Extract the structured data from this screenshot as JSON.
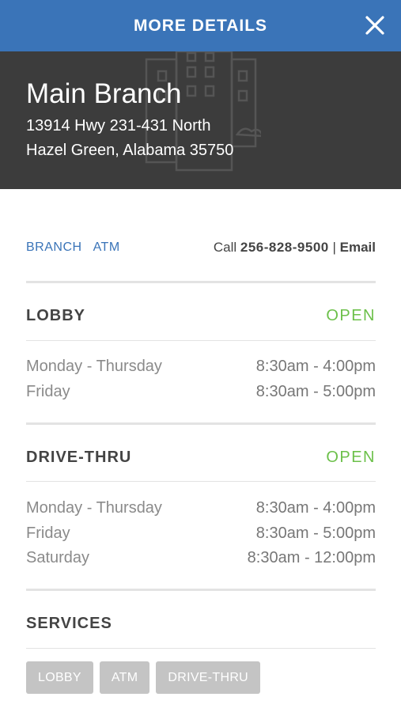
{
  "header": {
    "title": "MORE DETAILS"
  },
  "branch": {
    "name": "Main Branch",
    "address_line1": "13914 Hwy 231-431 North",
    "address_line2": "Hazel Green, Alabama 35750"
  },
  "links": {
    "branch": "BRANCH",
    "atm": "ATM",
    "call_label": "Call",
    "phone": "256-828-9500",
    "separator": "|",
    "email": "Email"
  },
  "lobby": {
    "title": "LOBBY",
    "status": "OPEN",
    "hours": [
      {
        "days": "Monday - Thursday",
        "time": "8:30am - 4:00pm"
      },
      {
        "days": "Friday",
        "time": "8:30am - 5:00pm"
      }
    ]
  },
  "drive_thru": {
    "title": "DRIVE-THRU",
    "status": "OPEN",
    "hours": [
      {
        "days": "Monday - Thursday",
        "time": "8:30am - 4:00pm"
      },
      {
        "days": "Friday",
        "time": "8:30am - 5:00pm"
      },
      {
        "days": "Saturday",
        "time": "8:30am - 12:00pm"
      }
    ]
  },
  "services": {
    "title": "SERVICES",
    "items": [
      "LOBBY",
      "ATM",
      "DRIVE-THRU"
    ]
  },
  "colors": {
    "header_bg": "#3a74b8",
    "hero_bg": "#3c3c3c",
    "open_status": "#6cc04a",
    "chip_bg": "#c4c4c4"
  },
  "icons": {
    "close": "close-icon",
    "hero": "building-icon"
  }
}
